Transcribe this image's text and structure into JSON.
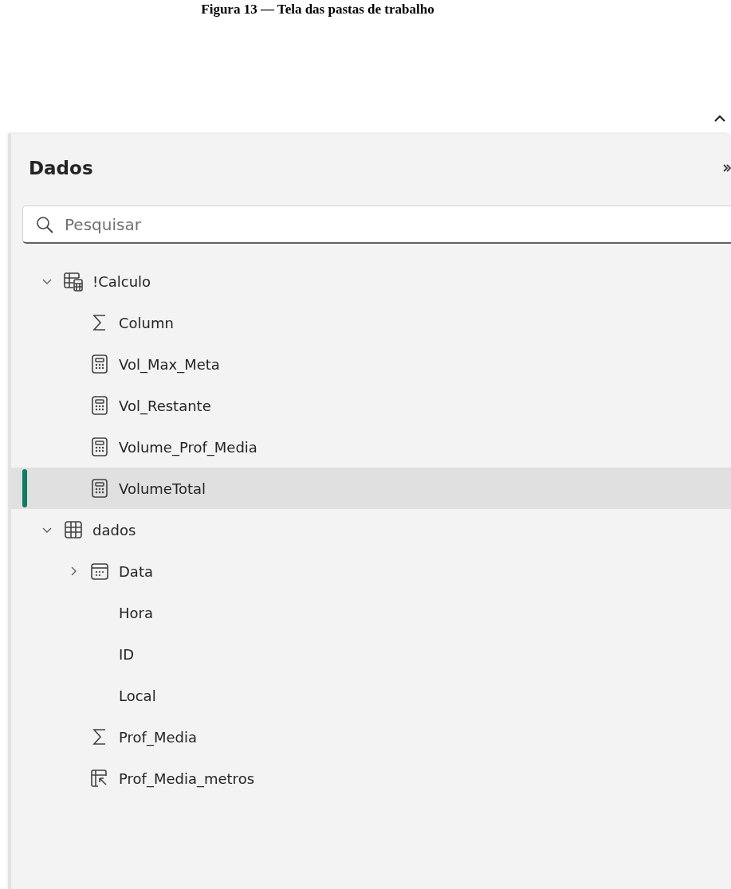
{
  "caption": "Figura 13 — Tela das pastas de trabalho",
  "pane": {
    "title": "Dados",
    "search": {
      "placeholder": "Pesquisar"
    },
    "tree": [
      {
        "label": "!Calculo",
        "kind": "table-calc",
        "expanded": true,
        "selected": false,
        "children": [
          {
            "label": "Column",
            "kind": "sum",
            "selected": false
          },
          {
            "label": "Vol_Max_Meta",
            "kind": "calculator",
            "selected": false
          },
          {
            "label": "Vol_Restante",
            "kind": "calculator",
            "selected": false
          },
          {
            "label": "Volume_Prof_Media",
            "kind": "calculator",
            "selected": false
          },
          {
            "label": "VolumeTotal",
            "kind": "calculator",
            "selected": true
          }
        ]
      },
      {
        "label": "dados",
        "kind": "table",
        "expanded": true,
        "selected": false,
        "children": [
          {
            "label": "Data",
            "kind": "calendar",
            "expanded": false,
            "selected": false
          },
          {
            "label": "Hora",
            "kind": "none",
            "selected": false
          },
          {
            "label": "ID",
            "kind": "none",
            "selected": false
          },
          {
            "label": "Local",
            "kind": "none",
            "selected": false
          },
          {
            "label": "Prof_Media",
            "kind": "sum",
            "selected": false
          },
          {
            "label": "Prof_Media_metros",
            "kind": "column-link",
            "selected": false
          }
        ]
      }
    ]
  }
}
